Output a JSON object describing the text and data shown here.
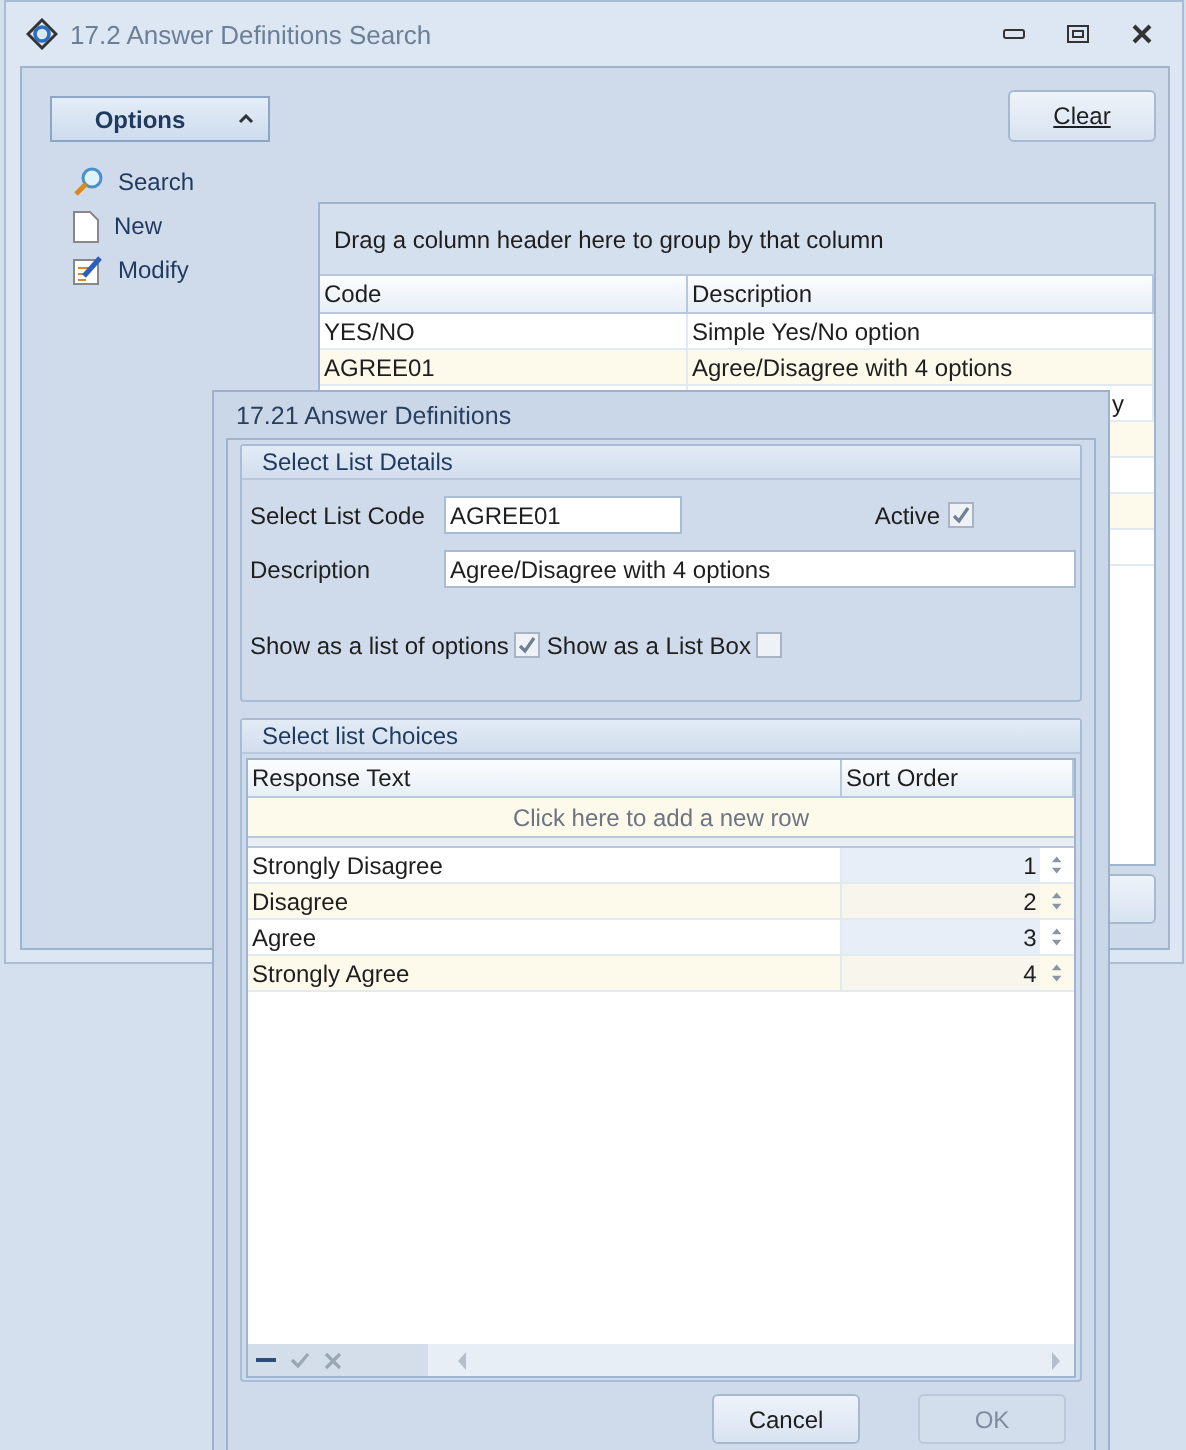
{
  "window": {
    "title": "17.2 Answer Definitions Search"
  },
  "options_panel": {
    "title": "Options",
    "expanded": true,
    "items": [
      {
        "label": "Search",
        "kind": "search"
      },
      {
        "label": "New",
        "kind": "new"
      },
      {
        "label": "Modify",
        "kind": "modify"
      }
    ]
  },
  "clear_button": {
    "label": "Clear"
  },
  "results": {
    "group_hint": "Drag a column header here to group by that column",
    "columns": [
      "Code",
      "Description"
    ],
    "rows": [
      {
        "code": "YES/NO",
        "description": "Simple Yes/No option"
      },
      {
        "code": "AGREE01",
        "description": "Agree/Disagree with 4 options"
      },
      {
        "description": "y",
        "kind": "partial"
      }
    ]
  },
  "dialog": {
    "title": "17.21 Answer Definitions",
    "details": {
      "title": "Select List Details",
      "code_label": "Select List Code",
      "code_value": "AGREE01",
      "active_label": "Active",
      "active": true,
      "description_label": "Description",
      "description_value": "Agree/Disagree with 4 options",
      "list_options_label": "Show as a list of options",
      "list_options": true,
      "list_box_label": "Show as a List Box",
      "list_box": false
    },
    "choices": {
      "title": "Select list Choices",
      "columns": [
        "Response Text",
        "Sort Order"
      ],
      "new_row_hint": "Click here to add a new row",
      "rows": [
        {
          "text": "Strongly Disagree",
          "order": "1"
        },
        {
          "text": "Disagree",
          "order": "2"
        },
        {
          "text": "Agree",
          "order": "3"
        },
        {
          "text": "Strongly Agree",
          "order": "4"
        }
      ]
    },
    "buttons": [
      {
        "label": "Cancel",
        "disabled": false
      },
      {
        "label": "OK",
        "disabled": true
      }
    ]
  }
}
